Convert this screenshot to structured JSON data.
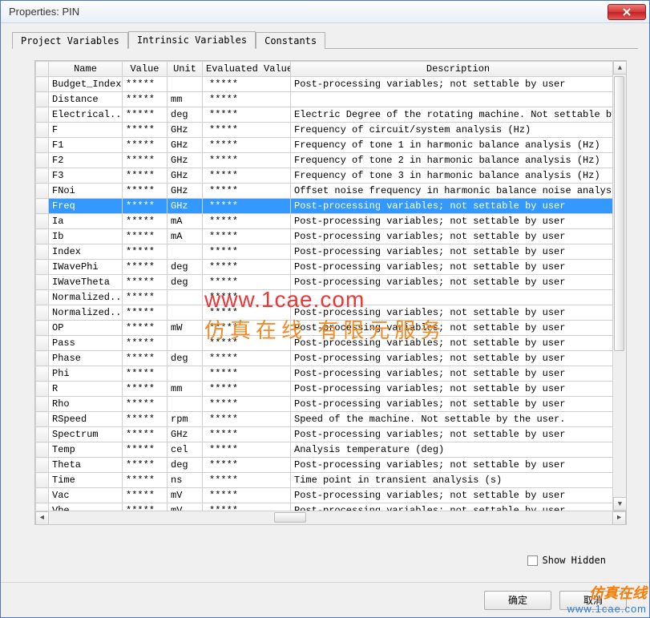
{
  "window": {
    "title": "Properties: PIN"
  },
  "tabs": [
    {
      "label": "Project Variables",
      "active": false
    },
    {
      "label": "Intrinsic Variables",
      "active": true
    },
    {
      "label": "Constants",
      "active": false
    }
  ],
  "columns": {
    "rowhdr": "",
    "name": "Name",
    "value": "Value",
    "unit": "Unit",
    "evaluated": "Evaluated Value",
    "description": "Description"
  },
  "rows": [
    {
      "name": "Budget_Index",
      "value": "*****",
      "unit": "",
      "evaluated": "*****",
      "description": "Post-processing variables; not settable by user",
      "selected": false
    },
    {
      "name": "Distance",
      "value": "*****",
      "unit": "mm",
      "evaluated": "*****",
      "description": "",
      "selected": false
    },
    {
      "name": "Electrical...",
      "value": "*****",
      "unit": "deg",
      "evaluated": "*****",
      "description": "Electric Degree of the rotating machine.  Not settable by the u",
      "selected": false
    },
    {
      "name": "F",
      "value": "*****",
      "unit": "GHz",
      "evaluated": "*****",
      "description": "Frequency of circuit/system analysis (Hz)",
      "selected": false
    },
    {
      "name": "F1",
      "value": "*****",
      "unit": "GHz",
      "evaluated": "*****",
      "description": "Frequency of tone 1 in harmonic balance analysis (Hz)",
      "selected": false
    },
    {
      "name": "F2",
      "value": "*****",
      "unit": "GHz",
      "evaluated": "*****",
      "description": "Frequency of tone 2 in harmonic balance analysis (Hz)",
      "selected": false
    },
    {
      "name": "F3",
      "value": "*****",
      "unit": "GHz",
      "evaluated": "*****",
      "description": "Frequency of tone 3 in harmonic balance analysis (Hz)",
      "selected": false
    },
    {
      "name": "FNoi",
      "value": "*****",
      "unit": "GHz",
      "evaluated": "*****",
      "description": "Offset noise frequency in harmonic balance noise analysis (Hz)",
      "selected": false
    },
    {
      "name": "Freq",
      "value": "*****",
      "unit": "GHz",
      "evaluated": "*****",
      "description": "Post-processing variables; not settable by user",
      "selected": true
    },
    {
      "name": "Ia",
      "value": "*****",
      "unit": "mA",
      "evaluated": "*****",
      "description": "Post-processing variables; not settable by user",
      "selected": false
    },
    {
      "name": "Ib",
      "value": "*****",
      "unit": "mA",
      "evaluated": "*****",
      "description": "Post-processing variables; not settable by user",
      "selected": false
    },
    {
      "name": "Index",
      "value": "*****",
      "unit": "",
      "evaluated": "*****",
      "description": "Post-processing variables; not settable by user",
      "selected": false
    },
    {
      "name": "IWavePhi",
      "value": "*****",
      "unit": "deg",
      "evaluated": "*****",
      "description": "Post-processing variables; not settable by user",
      "selected": false
    },
    {
      "name": "IWaveTheta",
      "value": "*****",
      "unit": "deg",
      "evaluated": "*****",
      "description": "Post-processing variables; not settable by user",
      "selected": false
    },
    {
      "name": "Normalized...",
      "value": "*****",
      "unit": "",
      "evaluated": "*****",
      "description": "",
      "selected": false
    },
    {
      "name": "Normalized...",
      "value": "*****",
      "unit": "",
      "evaluated": "*****",
      "description": "Post-processing variables; not settable by user",
      "selected": false
    },
    {
      "name": "OP",
      "value": "*****",
      "unit": "mW",
      "evaluated": "*****",
      "description": "Post-processing variables; not settable by user",
      "selected": false
    },
    {
      "name": "Pass",
      "value": "*****",
      "unit": "",
      "evaluated": "*****",
      "description": "Post-processing variables; not settable by user",
      "selected": false
    },
    {
      "name": "Phase",
      "value": "*****",
      "unit": "deg",
      "evaluated": "*****",
      "description": "Post-processing variables; not settable by user",
      "selected": false
    },
    {
      "name": "Phi",
      "value": "*****",
      "unit": "",
      "evaluated": "*****",
      "description": "Post-processing variables; not settable by user",
      "selected": false
    },
    {
      "name": "R",
      "value": "*****",
      "unit": "mm",
      "evaluated": "*****",
      "description": "Post-processing variables; not settable by user",
      "selected": false
    },
    {
      "name": "Rho",
      "value": "*****",
      "unit": "",
      "evaluated": "*****",
      "description": "Post-processing variables; not settable by user",
      "selected": false
    },
    {
      "name": "RSpeed",
      "value": "*****",
      "unit": "rpm",
      "evaluated": "*****",
      "description": "Speed of the machine.  Not settable by the user.",
      "selected": false
    },
    {
      "name": "Spectrum",
      "value": "*****",
      "unit": "GHz",
      "evaluated": "*****",
      "description": "Post-processing variables; not settable by user",
      "selected": false
    },
    {
      "name": "Temp",
      "value": "*****",
      "unit": "cel",
      "evaluated": "*****",
      "description": "Analysis temperature (deg)",
      "selected": false
    },
    {
      "name": "Theta",
      "value": "*****",
      "unit": "deg",
      "evaluated": "*****",
      "description": "Post-processing variables; not settable by user",
      "selected": false
    },
    {
      "name": "Time",
      "value": "*****",
      "unit": "ns",
      "evaluated": "*****",
      "description": "Time point in transient analysis (s)",
      "selected": false
    },
    {
      "name": "Vac",
      "value": "*****",
      "unit": "mV",
      "evaluated": "*****",
      "description": "Post-processing variables; not settable by user",
      "selected": false
    },
    {
      "name": "Vbe",
      "value": "*****",
      "unit": "mV",
      "evaluated": "*****",
      "description": "Post-processing variables; not settable by user",
      "selected": false
    }
  ],
  "showHidden": {
    "label": "Show Hidden",
    "checked": false
  },
  "buttons": {
    "ok": "确定",
    "cancel": "取消"
  },
  "watermark": {
    "line1": "www.1cae.com",
    "line2": "仿真在线 有限元服务",
    "badge_title": "仿真在线",
    "badge_url": "www.1cae.com"
  }
}
